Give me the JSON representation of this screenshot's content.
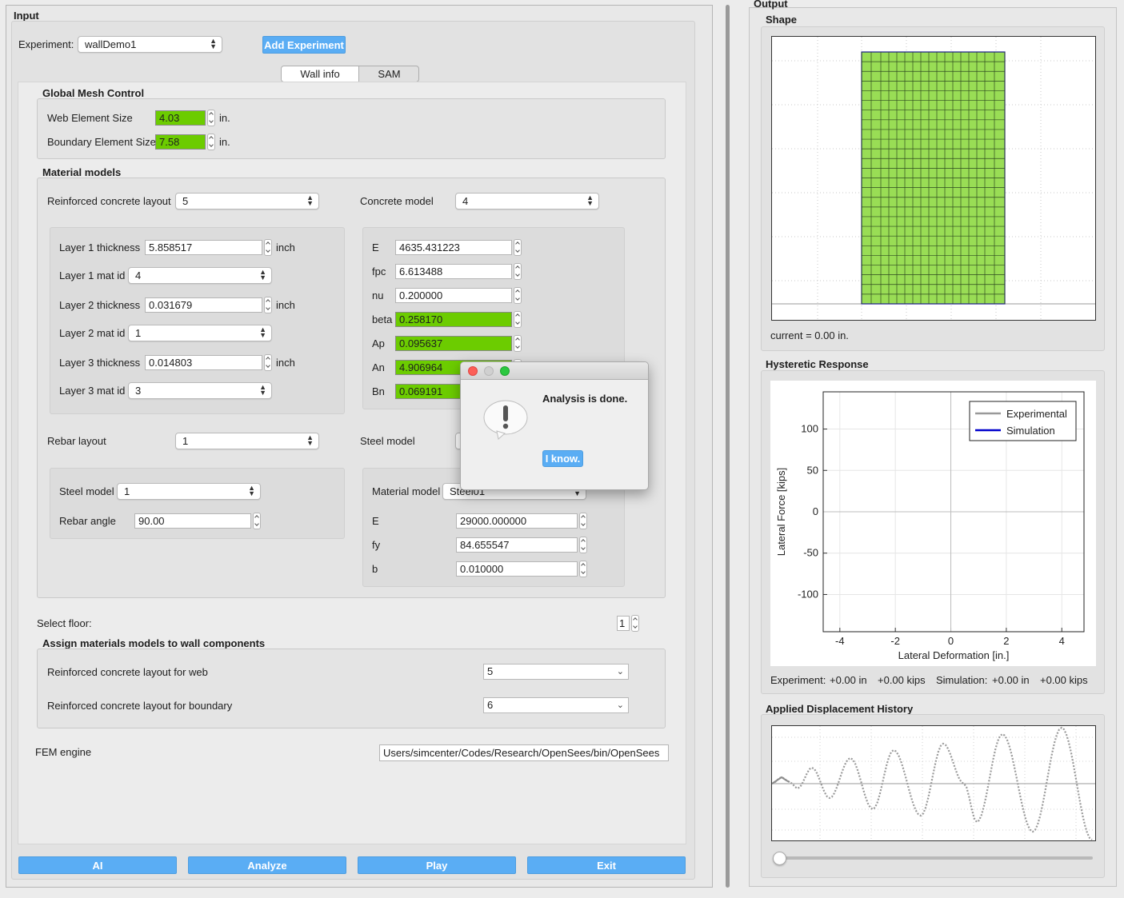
{
  "input": {
    "title": "Input",
    "experiment_label": "Experiment:",
    "experiment_value": "wallDemo1",
    "add_experiment": "Add Experiment",
    "tabs": [
      "Wall info",
      "SAM"
    ]
  },
  "mesh": {
    "title": "Global Mesh Control",
    "web_label": "Web Element Size",
    "web_value": "4.03",
    "web_unit": "in.",
    "boundary_label": "Boundary Element Size",
    "boundary_value": "7.58",
    "boundary_unit": "in."
  },
  "material": {
    "title": "Material models",
    "rc_layout_label": "Reinforced concrete layout",
    "rc_layout_value": "5",
    "concrete_model_label": "Concrete model",
    "concrete_model_value": "4",
    "layers": [
      {
        "label": "Layer 1 thickness",
        "value": "5.858517",
        "unit": "inch"
      },
      {
        "label": "Layer 1 mat id",
        "value": "4"
      },
      {
        "label": "Layer 2 thickness",
        "value": "0.031679",
        "unit": "inch"
      },
      {
        "label": "Layer 2 mat id",
        "value": "1"
      },
      {
        "label": "Layer 3 thickness",
        "value": "0.014803",
        "unit": "inch"
      },
      {
        "label": "Layer 3 mat id",
        "value": "3"
      }
    ],
    "concrete_params": [
      {
        "label": "E",
        "value": "4635.431223"
      },
      {
        "label": "fpc",
        "value": "6.613488"
      },
      {
        "label": "nu",
        "value": "0.200000"
      },
      {
        "label": "beta",
        "value": "0.258170"
      },
      {
        "label": "Ap",
        "value": "0.095637"
      },
      {
        "label": "An",
        "value": "4.906964"
      },
      {
        "label": "Bn",
        "value": "0.069191"
      }
    ],
    "rebar_layout_label": "Rebar layout",
    "rebar_layout_value": "1",
    "steel_model_label": "Steel model",
    "steel_model_inner_label": "Steel model",
    "steel_model_inner_value": "1",
    "rebar_angle_label": "Rebar angle",
    "rebar_angle_value": "90.00",
    "material_model_label": "Material model",
    "material_model_value": "Steel01",
    "steel_params": [
      {
        "label": "E",
        "value": "29000.000000"
      },
      {
        "label": "fy",
        "value": "84.655547"
      },
      {
        "label": "b",
        "value": "0.010000"
      }
    ]
  },
  "floor": {
    "label": "Select floor:",
    "value": "1"
  },
  "assign": {
    "title": "Assign materials models to wall components",
    "web_label": "Reinforced concrete layout for web",
    "web_value": "5",
    "boundary_label": "Reinforced concrete layout for boundary",
    "boundary_value": "6"
  },
  "fem": {
    "label": "FEM engine",
    "value": "Users/simcenter/Codes/Research/OpenSees/bin/OpenSees"
  },
  "bottom_buttons": [
    "AI",
    "Analyze",
    "Play",
    "Exit"
  ],
  "output": {
    "title": "Output",
    "shape_title": "Shape",
    "current_text": "current = 0.00 in.",
    "hyst_title": "Hysteretic Response",
    "hyst_xlabel": "Lateral Deformation [in.]",
    "hyst_ylabel": "Lateral Force [kips]",
    "legend": [
      "Experimental",
      "Simulation"
    ],
    "status": {
      "exp_label": "Experiment:",
      "exp_disp": "+0.00 in",
      "exp_force": "+0.00 kips",
      "sim_label": "Simulation:",
      "sim_disp": "+0.00 in",
      "sim_force": "+0.00 kips"
    },
    "disp_title": "Applied Displacement History",
    "slider_position": 0
  },
  "dialog": {
    "message": "Analysis is done.",
    "button": "I know."
  },
  "chart_data": {
    "type": "line",
    "xlabel": "Lateral Deformation [in.]",
    "ylabel": "Lateral Force [kips]",
    "xticks": [
      "-4",
      "-2",
      "0",
      "2",
      "4"
    ],
    "yticks": [
      "100",
      "50",
      "0",
      "-50",
      "-100"
    ],
    "xlim": [
      -4.6,
      4.8
    ],
    "ylim": [
      -145,
      145
    ],
    "grid": true,
    "legend_position": "top-right",
    "series": [
      {
        "name": "Experimental",
        "color": "#999999",
        "values": []
      },
      {
        "name": "Simulation",
        "color": "#0000cc",
        "values": []
      }
    ]
  },
  "colors": {
    "accent": "#5aadf4",
    "highlight": "#6ccc00",
    "mesh": "#99dd55"
  }
}
